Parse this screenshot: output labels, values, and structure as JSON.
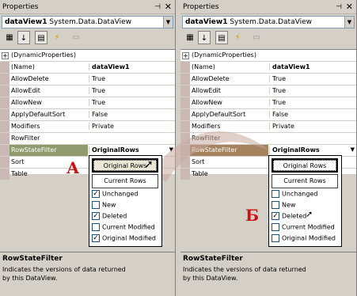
{
  "panes": [
    {
      "title": "Properties",
      "object_name": "dataView1",
      "object_type": "System.Data.DataView",
      "rows": [
        {
          "name": "(DynamicProperties)",
          "value": "",
          "kind": "category"
        },
        {
          "name": "(Name)",
          "value": "dataView1",
          "bold": true
        },
        {
          "name": "AllowDelete",
          "value": "True"
        },
        {
          "name": "AllowEdit",
          "value": "True"
        },
        {
          "name": "AllowNew",
          "value": "True"
        },
        {
          "name": "ApplyDefaultSort",
          "value": "False"
        },
        {
          "name": "Modifiers",
          "value": "Private"
        },
        {
          "name": "RowFilter",
          "value": ""
        },
        {
          "name": "RowStateFilter",
          "value": "OriginalRows",
          "bold": true,
          "selected": true
        },
        {
          "name": "Sort",
          "value": ""
        },
        {
          "name": "Table",
          "value": ""
        }
      ],
      "popup": {
        "button1": "Original Rows",
        "button2": "Current Rows",
        "options": [
          {
            "label": "Unchanged",
            "checked": true
          },
          {
            "label": "New",
            "checked": false
          },
          {
            "label": "Deleted",
            "checked": true
          },
          {
            "label": "Current Modified",
            "checked": false
          },
          {
            "label": "Original Modified",
            "checked": true
          }
        ]
      },
      "marker": "А",
      "description_title": "RowStateFilter",
      "description_text": "Indicates the versions of data returned by this DataView."
    },
    {
      "title": "Properties",
      "object_name": "dataView1",
      "object_type": "System.Data.DataView",
      "rows": [
        {
          "name": "(DynamicProperties)",
          "value": "",
          "kind": "category"
        },
        {
          "name": "(Name)",
          "value": "dataView1",
          "bold": true
        },
        {
          "name": "AllowDelete",
          "value": "True"
        },
        {
          "name": "AllowEdit",
          "value": "True"
        },
        {
          "name": "AllowNew",
          "value": "True"
        },
        {
          "name": "ApplyDefaultSort",
          "value": "False"
        },
        {
          "name": "Modifiers",
          "value": "Private"
        },
        {
          "name": "RowFilter",
          "value": ""
        },
        {
          "name": "RowStateFilter",
          "value": "OriginalRows",
          "bold": true,
          "selected": true
        },
        {
          "name": "Sort",
          "value": ""
        },
        {
          "name": "Table",
          "value": ""
        }
      ],
      "popup": {
        "button1": "Original Rows",
        "button2": "Current Rows",
        "options": [
          {
            "label": "Unchanged",
            "checked": false
          },
          {
            "label": "New",
            "checked": false
          },
          {
            "label": "Deleted",
            "checked": true
          },
          {
            "label": "Current Modified",
            "checked": false
          },
          {
            "label": "Original Modified",
            "checked": false
          }
        ]
      },
      "marker": "Б",
      "description_title": "RowStateFilter",
      "description_text": "Indicates the versions of data returned by this DataView."
    }
  ],
  "icons": {
    "pin": "pin-icon",
    "close": "close-icon",
    "categorized": "categorized-icon",
    "alphabetical": "alphabetical-icon",
    "properties": "properties-icon",
    "events": "events-icon",
    "property_pages": "property-pages-icon"
  }
}
